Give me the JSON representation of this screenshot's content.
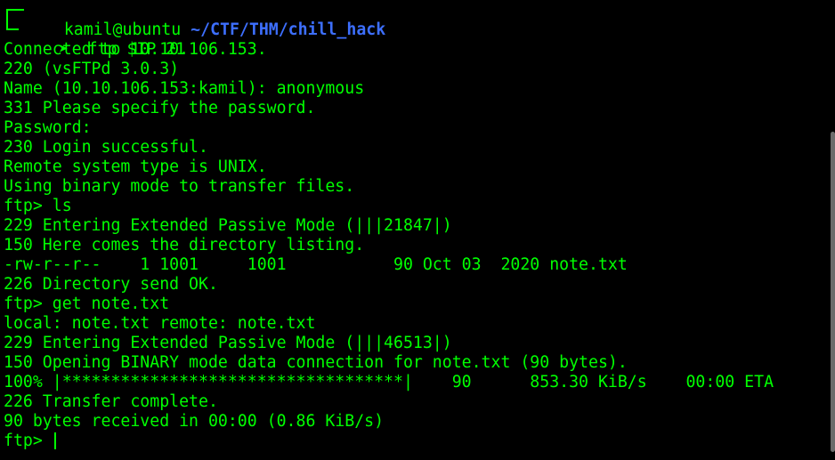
{
  "prompt": {
    "user_host": "kamil@ubuntu",
    "path": "~/CTF/THM/chill_hack",
    "command": "ftp $IP 21"
  },
  "output_lines": [
    "Connected to 10.10.106.153.",
    "220 (vsFTPd 3.0.3)",
    "Name (10.10.106.153:kamil): anonymous",
    "331 Please specify the password.",
    "Password:",
    "230 Login successful.",
    "Remote system type is UNIX.",
    "Using binary mode to transfer files.",
    "ftp> ls",
    "229 Entering Extended Passive Mode (|||21847|)",
    "150 Here comes the directory listing.",
    "-rw-r--r--    1 1001     1001           90 Oct 03  2020 note.txt",
    "226 Directory send OK.",
    "ftp> get note.txt",
    "local: note.txt remote: note.txt",
    "229 Entering Extended Passive Mode (|||46513|)",
    "150 Opening BINARY mode data connection for note.txt (90 bytes).",
    "100% |***********************************|    90      853.30 KiB/s    00:00 ETA",
    "226 Transfer complete.",
    "90 bytes received in 00:00 (0.86 KiB/s)"
  ],
  "final_prompt": "ftp> ",
  "colors": {
    "background": "#000000",
    "text": "#00ff00",
    "path": "#3d6fff",
    "scrollbar": "#6b6b6b"
  }
}
